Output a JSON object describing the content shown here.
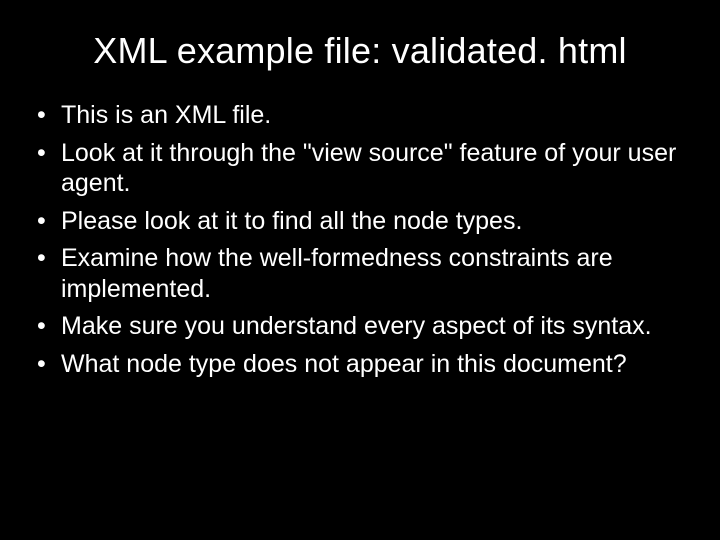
{
  "slide": {
    "title": "XML example file: validated. html",
    "bullets": [
      "This is an XML file.",
      "Look at it through the \"view source\" feature of your user agent.",
      "Please look at it to find all the node types.",
      "Examine how the well-formedness constraints are implemented.",
      "Make sure you understand every aspect of its syntax.",
      "What node type does not appear in this document?"
    ]
  }
}
